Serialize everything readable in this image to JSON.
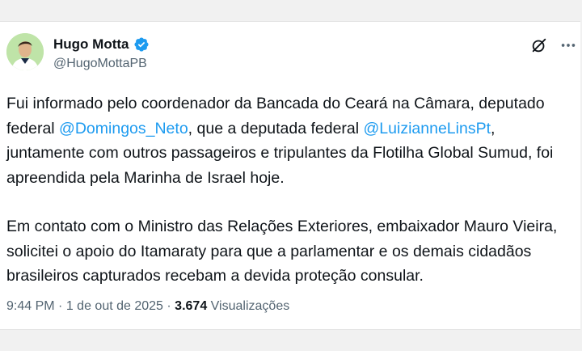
{
  "author": {
    "display_name": "Hugo Motta",
    "handle": "@HugoMottaPB",
    "verified_color": "#1d9bf0",
    "avatar_icon": "profile-photo"
  },
  "icons": {
    "grok": "grok-icon",
    "more": "more-options-icon"
  },
  "tweet": {
    "p1_part1": "Fui informado pelo coordenador da Bancada do Ceará na Câmara, deputado federal ",
    "mention1": "@Domingos_Neto",
    "p1_part2": ", que a deputada federal ",
    "mention2": "@LuizianneLinsPt",
    "p1_part3": ", juntamente com outros passageiros e tripulantes da Flotilha Global Sumud, foi apreendida pela Marinha de Israel hoje.",
    "p2": "Em contato com o Ministro das Relações Exteriores, embaixador Mauro Vieira, solicitei o apoio do Itamaraty para que a parlamentar e os demais cidadãos brasileiros capturados recebam a devida proteção consular."
  },
  "meta": {
    "time": "9:44 PM",
    "separator": "·",
    "date": "1 de out de 2025",
    "views_count": "3.674",
    "views_label": "Visualizações"
  },
  "colors": {
    "link": "#1d9bf0",
    "text": "#0f1419",
    "secondary": "#536471"
  }
}
